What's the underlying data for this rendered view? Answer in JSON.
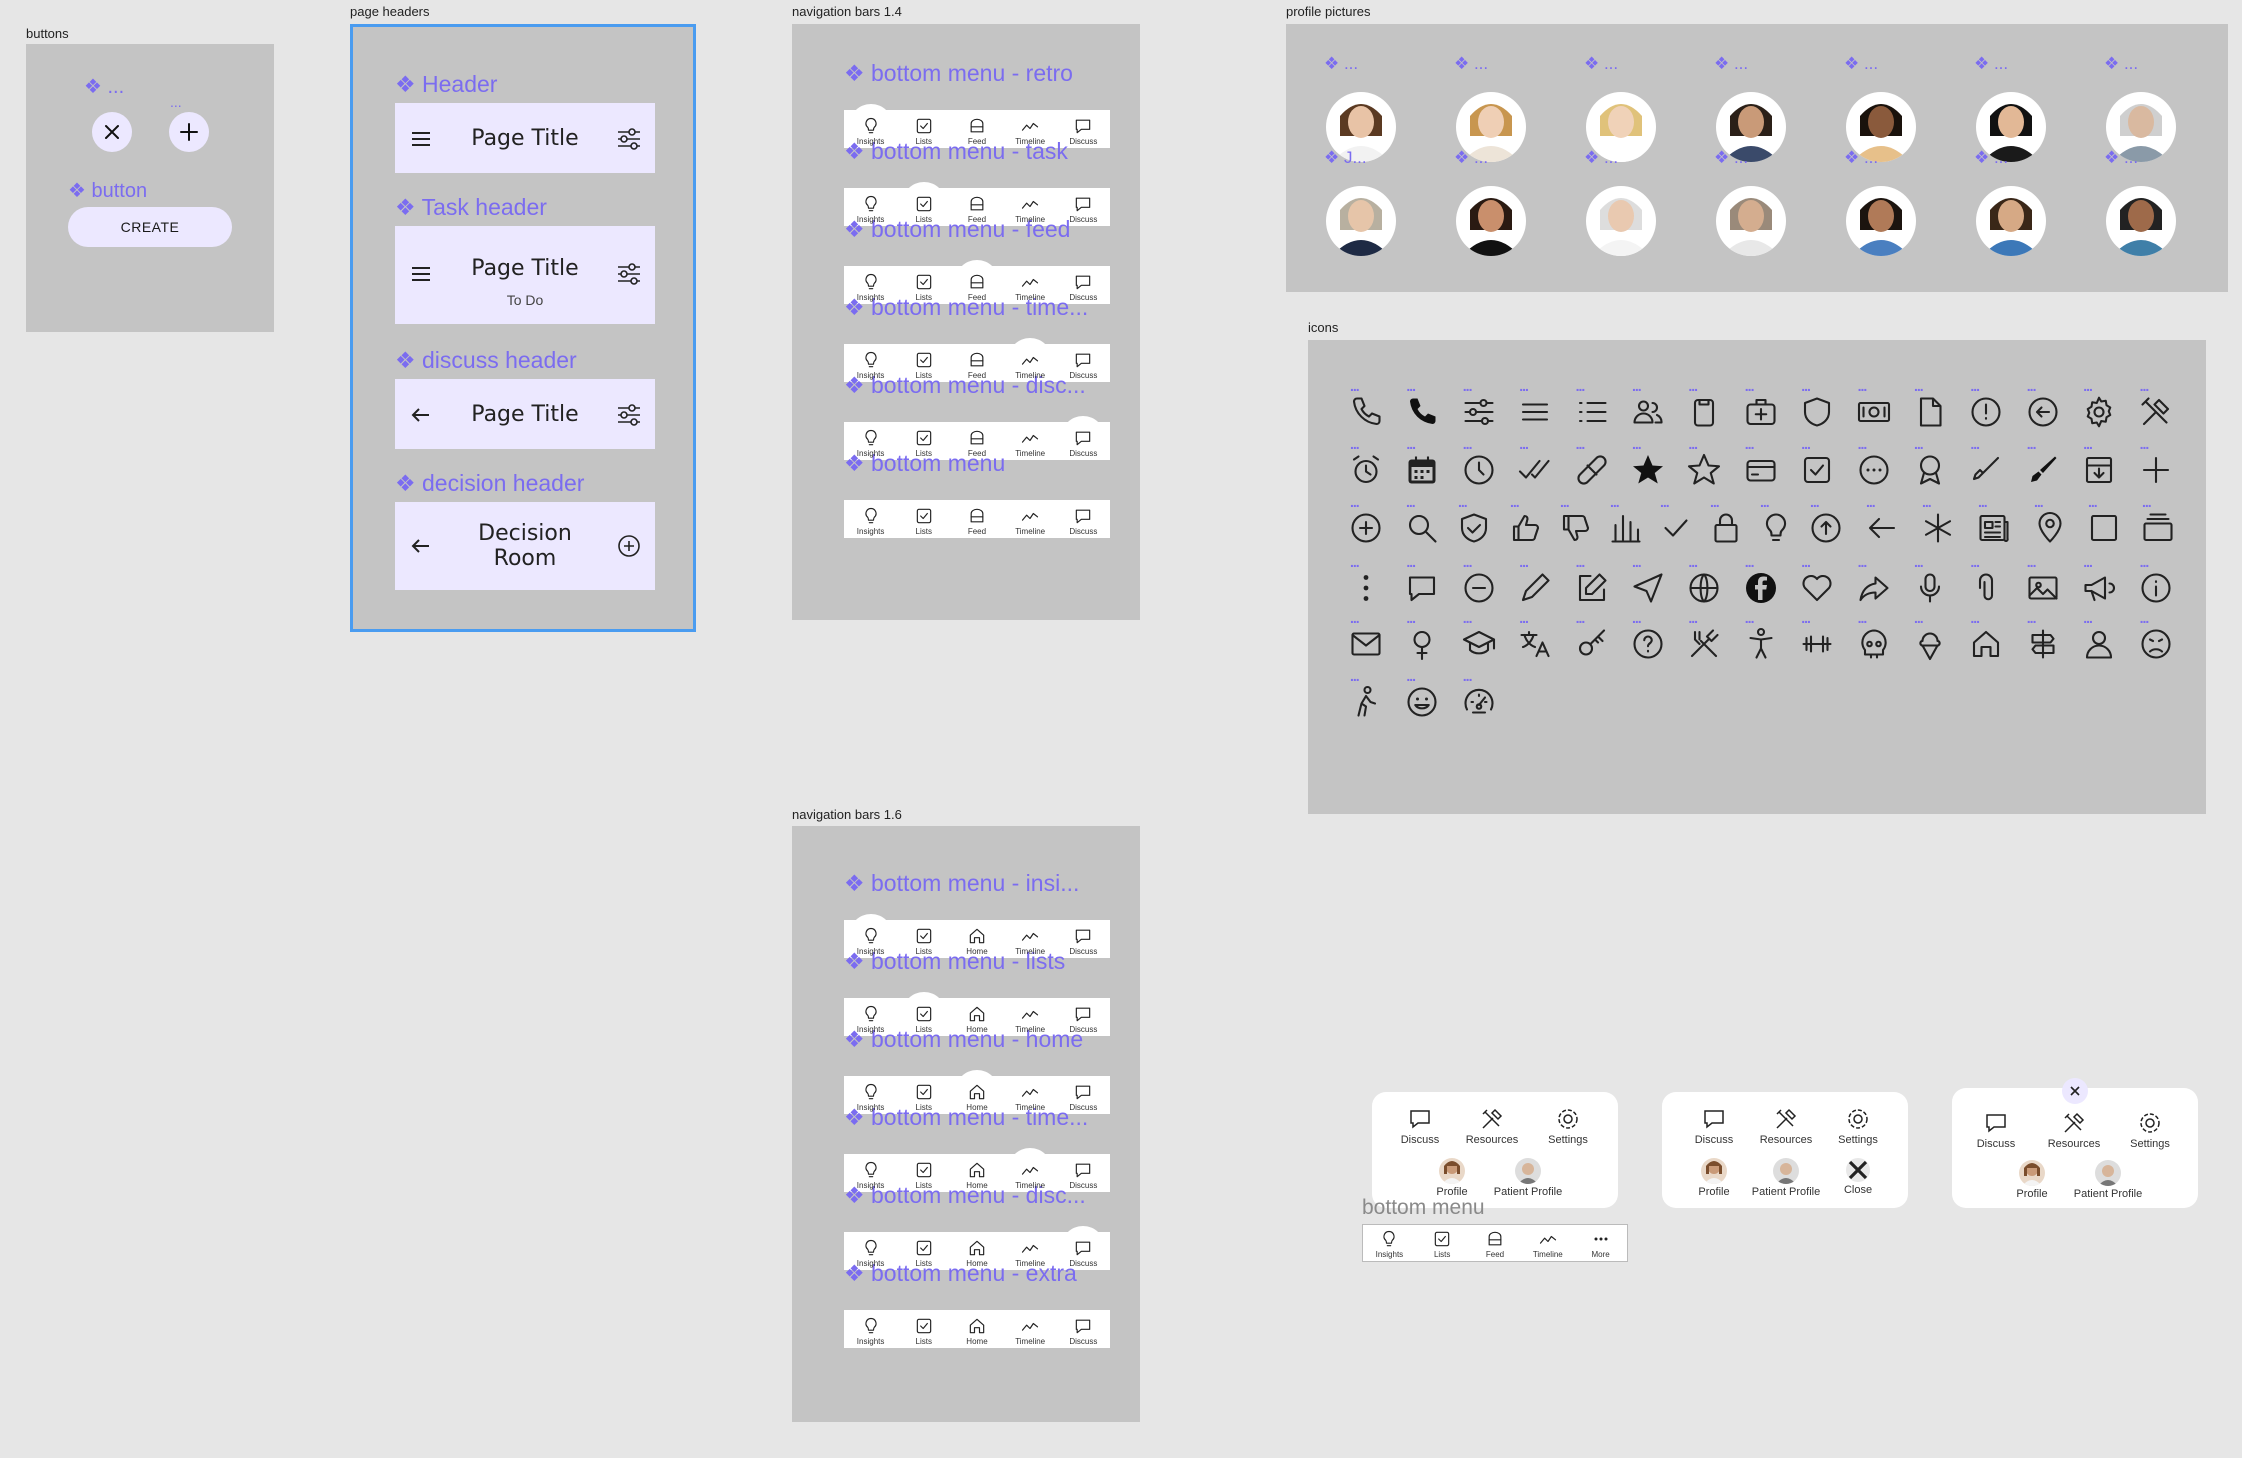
{
  "frames": {
    "buttons": "buttons",
    "page_headers": "page headers",
    "nav14": "navigation bars 1.4",
    "nav16": "navigation bars 1.6",
    "profiles": "profile pictures",
    "icons": "icons"
  },
  "buttons_panel": {
    "dots_title": "❖ ...",
    "dots_small": "...",
    "button_title": "❖ button",
    "create_label": "CREATE"
  },
  "headers": {
    "header_title": "❖ Header",
    "task_title": "❖ Task header",
    "discuss_title": "❖ discuss header",
    "decision_title": "❖ decision header",
    "page_title": "Page Title",
    "to_do": "To Do",
    "decision_line1": "Decision",
    "decision_line2": "Room"
  },
  "nav14": {
    "titles": [
      "❖ bottom menu - retro",
      "❖ bottom menu - task",
      "❖ bottom menu - feed",
      "❖ bottom menu - time...",
      "❖ bottom menu - disc...",
      "❖ bottom menu"
    ],
    "items": [
      "Insights",
      "Lists",
      "Feed",
      "Timeline",
      "Discuss"
    ]
  },
  "nav16": {
    "titles": [
      "❖ bottom menu - insi...",
      "❖ bottom menu - lists",
      "❖ bottom menu - home",
      "❖ bottom menu - time...",
      "❖ bottom menu - disc...",
      "❖ bottom menu - extra"
    ],
    "items": [
      "Insights",
      "Lists",
      "Home",
      "Timeline",
      "Discuss"
    ]
  },
  "profiles": {
    "row1_label": "❖ ...",
    "row2_first_label": "❖ J...",
    "row2_label": "❖ ..."
  },
  "icon_names": [
    [
      "phone-outline-icon",
      "phone-filled-icon",
      "sliders-icon",
      "menu-icon",
      "list-icon",
      "users-icon",
      "clipboard-icon",
      "medkit-icon",
      "shield-icon",
      "money-icon",
      "file-icon",
      "alert-circle-icon",
      "arrow-left-circle-icon",
      "gear-icon",
      "tools-icon"
    ],
    [
      "alarm-icon",
      "calendar-icon",
      "clock-icon",
      "double-check-icon",
      "bandage-icon",
      "star-filled-icon",
      "star-outline-icon",
      "card-icon",
      "checkbox-icon",
      "more-circle-icon",
      "award-icon",
      "brush-outline-icon",
      "brush-filled-icon",
      "archive-icon",
      "plus-icon"
    ],
    [
      "plus-circle-icon",
      "search-icon",
      "shield-check-icon",
      "thumbs-up-icon",
      "thumbs-down-icon",
      "bar-chart-icon",
      "check-icon",
      "lock-icon",
      "lightbulb-icon",
      "arrow-up-circle-icon",
      "arrow-left-icon",
      "asterisk-icon",
      "newspaper-icon",
      "map-pin-icon",
      "square-icon",
      "stack-icon"
    ],
    [
      "more-vertical-icon",
      "chat-icon",
      "minus-circle-icon",
      "pencil-icon",
      "edit-icon",
      "send-icon",
      "globe-icon",
      "facebook-icon",
      "heart-icon",
      "share-icon",
      "microphone-icon",
      "paperclip-icon",
      "image-icon",
      "megaphone-icon",
      "info-icon"
    ],
    [
      "mail-icon",
      "female-icon",
      "graduation-icon",
      "translate-icon",
      "key-icon",
      "help-circle-icon",
      "utensils-icon",
      "accessibility-icon",
      "dumbbell-icon",
      "skull-icon",
      "ice-cream-icon",
      "home-icon",
      "signpost-icon",
      "user-icon",
      "sad-face-icon"
    ],
    [
      "walking-icon",
      "happy-face-icon",
      "gauge-icon"
    ]
  ],
  "popups": {
    "discuss": "Discuss",
    "resources": "Resources",
    "settings": "Settings",
    "profile": "Profile",
    "patient_profile": "Patient Profile",
    "close": "Close"
  },
  "bottom_menu_more": {
    "title": "bottom menu",
    "items": [
      "Insights",
      "Lists",
      "Feed",
      "Timeline",
      "More"
    ]
  },
  "colors": {
    "accent": "#7b6cf0",
    "selection": "#4a9cf0",
    "panel": "#c4c4c4",
    "header_bg": "#ece8ff"
  }
}
